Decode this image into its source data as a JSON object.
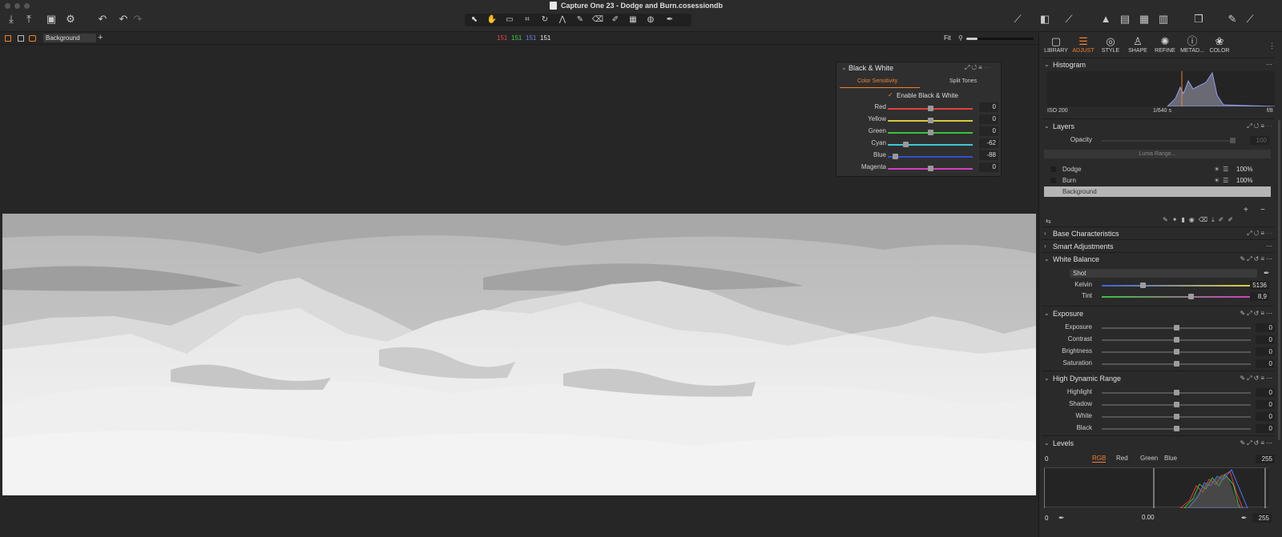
{
  "window": {
    "title": "Capture One 23 - Dodge and Burn.cosessiondb"
  },
  "toolbar": {
    "left_icons": [
      "import-icon",
      "export-icon",
      "save-icon",
      "process-icon",
      "undo-history-icon",
      "undo-icon",
      "redo-icon"
    ],
    "tool_icons": [
      "cursor-icon",
      "hand-icon",
      "camera-icon",
      "crop-icon",
      "rotate-icon",
      "keystone-icon",
      "brush-icon",
      "eraser-icon",
      "gradient-icon",
      "linear-gradient-icon",
      "radial-gradient-icon",
      "picker-icon"
    ],
    "right_icons": [
      "wand-icon",
      "compare-icon",
      "brush-pointer-icon",
      "warning-icon",
      "grid-icon",
      "browser-icon",
      "layout-icon",
      "settings-icon"
    ]
  },
  "subbar": {
    "layer_select": "Background",
    "readout_r": "151",
    "readout_g": "151",
    "readout_b": "151",
    "readout_l": "151",
    "zoom_label": "Fit"
  },
  "bw_panel": {
    "title": "Black & White",
    "tab_active": "Color Sensitivity",
    "tab_other": "Split Tones",
    "enable_label": "Enable Black & White",
    "enabled": true,
    "sliders": [
      {
        "label": "Red",
        "value": "0",
        "pos": 0.5,
        "color": "#e04040"
      },
      {
        "label": "Yellow",
        "value": "0",
        "pos": 0.5,
        "color": "#d8c840"
      },
      {
        "label": "Green",
        "value": "0",
        "pos": 0.5,
        "color": "#40c040"
      },
      {
        "label": "Cyan",
        "value": "-62",
        "pos": 0.19,
        "color": "#40c8d8"
      },
      {
        "label": "Blue",
        "value": "-88",
        "pos": 0.06,
        "color": "#3050d0"
      },
      {
        "label": "Magenta",
        "value": "0",
        "pos": 0.5,
        "color": "#d040c0"
      }
    ]
  },
  "right_panel": {
    "tabs": [
      {
        "label": "LIBRARY",
        "icon": "folder-icon"
      },
      {
        "label": "ADJUST",
        "icon": "sliders-icon",
        "active": true
      },
      {
        "label": "STYLE",
        "icon": "style-icon"
      },
      {
        "label": "SHAPE",
        "icon": "shape-icon"
      },
      {
        "label": "REFINE",
        "icon": "refine-icon"
      },
      {
        "label": "METAD...",
        "icon": "info-icon"
      },
      {
        "label": "COLOR",
        "icon": "color-icon"
      }
    ],
    "histogram": {
      "title": "Histogram",
      "iso": "ISO 200",
      "shutter": "1/640 s",
      "aperture": "f/8"
    },
    "layers": {
      "title": "Layers",
      "opacity_label": "Opacity",
      "opacity_value": "100",
      "luma_range": "Luma Range...",
      "items": [
        {
          "name": "Dodge",
          "opacity": "100%"
        },
        {
          "name": "Burn",
          "opacity": "100%"
        },
        {
          "name": "Background",
          "opacity": ""
        }
      ]
    },
    "sections": {
      "base": "Base Characteristics",
      "smart": "Smart Adjustments",
      "wb": "White Balance",
      "exposure": "Exposure",
      "hdr": "High Dynamic Range",
      "levels": "Levels"
    },
    "white_balance": {
      "mode_label": "Mode",
      "mode_value": "Shot",
      "kelvin_label": "Kelvin",
      "kelvin_value": "5136",
      "kelvin_pos": 0.26,
      "tint_label": "Tint",
      "tint_value": "8,9",
      "tint_pos": 0.58
    },
    "exposure": [
      {
        "label": "Exposure",
        "value": "0"
      },
      {
        "label": "Contrast",
        "value": "0"
      },
      {
        "label": "Brightness",
        "value": "0"
      },
      {
        "label": "Saturation",
        "value": "0"
      }
    ],
    "hdr": [
      {
        "label": "Highlight",
        "value": "0"
      },
      {
        "label": "Shadow",
        "value": "0"
      },
      {
        "label": "White",
        "value": "0"
      },
      {
        "label": "Black",
        "value": "0"
      }
    ],
    "levels": {
      "tabs": [
        "RGB",
        "Red",
        "Green",
        "Blue"
      ],
      "input_low": "0",
      "input_high": "255",
      "output_low": "0",
      "midpoint": "0.00",
      "output_high": "255"
    }
  }
}
